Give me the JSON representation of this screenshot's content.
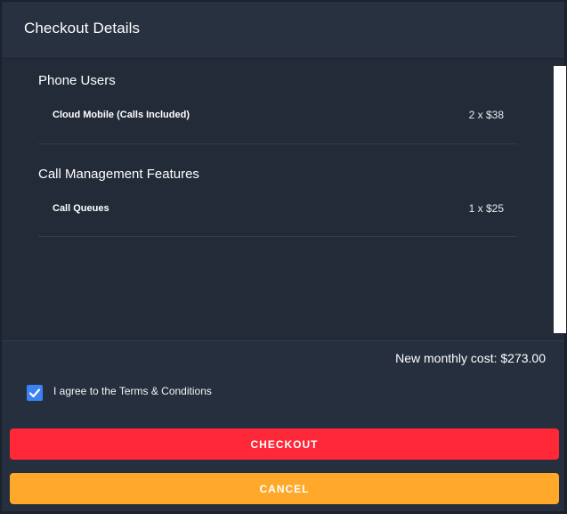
{
  "modal": {
    "title": "Checkout Details"
  },
  "sections": [
    {
      "title": "Phone Users",
      "items": [
        {
          "name": "Cloud Mobile (Calls Included)",
          "quantity": "2 x $38"
        }
      ]
    },
    {
      "title": "Call Management Features",
      "items": [
        {
          "name": "Call Queues",
          "quantity": "1 x $25"
        }
      ]
    }
  ],
  "summary": {
    "total_text": "New monthly cost: $273.00"
  },
  "terms": {
    "checked": true,
    "label": "I agree to the Terms & Conditions",
    "icon": "checkmark-icon"
  },
  "buttons": {
    "checkout": "CHECKOUT",
    "cancel": "CANCEL"
  },
  "colors": {
    "checkout": "#ff2838",
    "cancel": "#ffa82a",
    "checkbox": "#3b82f6",
    "background": "#262f3d"
  }
}
